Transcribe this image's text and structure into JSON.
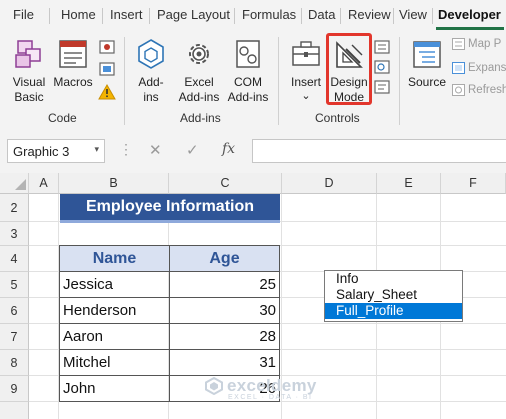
{
  "tabs": [
    "File",
    "Home",
    "Insert",
    "Page Layout",
    "Formulas",
    "Data",
    "Review",
    "View",
    "Developer"
  ],
  "active_tab": "Developer",
  "ribbon": {
    "code": {
      "label": "Code",
      "visual_basic_line1": "Visual",
      "visual_basic_line2": "Basic",
      "macros": "Macros"
    },
    "addins": {
      "label": "Add-ins",
      "addins_line1": "Add-",
      "addins_line2": "ins",
      "excel_addins_line1": "Excel",
      "excel_addins_line2": "Add-ins",
      "com_addins_line1": "COM",
      "com_addins_line2": "Add-ins"
    },
    "controls": {
      "label": "Controls",
      "insert": "Insert",
      "insert_arrow": "⌄",
      "design_mode_line1": "Design",
      "design_mode_line2": "Mode"
    },
    "xml": {
      "source": "Source",
      "map_properties": "Map P",
      "expansion_packs": "Expans",
      "refresh_data": "Refresh"
    }
  },
  "formula_bar": {
    "name_box": "Graphic 3",
    "name_box_arrow": "▾",
    "cancel": "✕",
    "enter": "✓",
    "fx": "fx",
    "value": ""
  },
  "columns": [
    "A",
    "B",
    "C",
    "D",
    "E",
    "F"
  ],
  "rows": [
    "2",
    "3",
    "4",
    "5",
    "6",
    "7",
    "8",
    "9"
  ],
  "sheet": {
    "title": "Employee Information",
    "headers": {
      "name": "Name",
      "age": "Age"
    },
    "employees": [
      {
        "name": "Jessica",
        "age": "25"
      },
      {
        "name": "Henderson",
        "age": "30"
      },
      {
        "name": "Aaron",
        "age": "28"
      },
      {
        "name": "Mitchel",
        "age": "31"
      },
      {
        "name": "John",
        "age": "26"
      }
    ]
  },
  "listbox": {
    "items": [
      "Info",
      "Salary_Sheet",
      "Full_Profile"
    ],
    "selected_index": 2
  },
  "watermark": {
    "name": "exceldemy",
    "tagline": "EXCEL · DATA · BI"
  },
  "colors": {
    "ribbon_bg": "#f3f3f3",
    "excel_green": "#217346",
    "title_fill": "#2f5597",
    "header_fill": "#d9e1f2",
    "highlight_red": "#e2362c",
    "selection_blue": "#0078d7"
  }
}
